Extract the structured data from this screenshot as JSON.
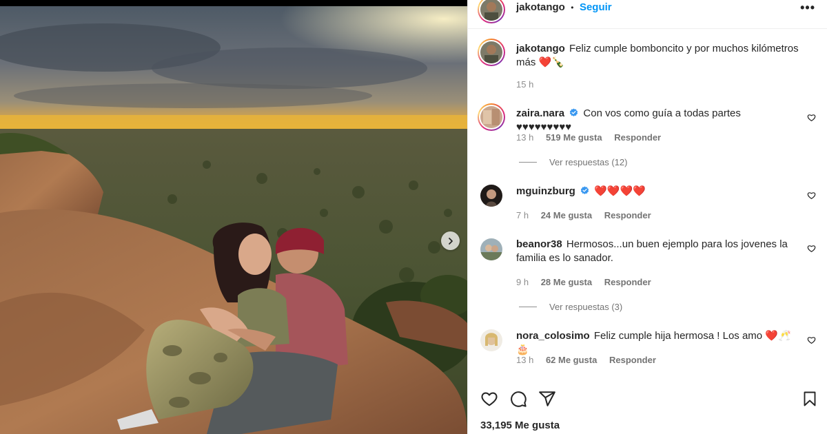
{
  "post": {
    "author": "jakotango",
    "separator": "•",
    "follow_label": "Seguir",
    "more_label": "•••",
    "caption_user": "jakotango",
    "caption_text": "Feliz cumple bomboncito y por muchos kilómetros más",
    "caption_emoji": "❤️🍾",
    "caption_time": "15 h",
    "likes": "33,195 Me gusta"
  },
  "comments": [
    {
      "user": "zaira.nara",
      "verified": true,
      "text": "Con vos como guía a todas partes ♥♥♥♥♥♥♥♥♥",
      "time": "13 h",
      "likes": "519 Me gusta",
      "reply": "Responder",
      "view_replies": "Ver respuestas (12)"
    },
    {
      "user": "mguinzburg",
      "verified": true,
      "text": "",
      "emoji": "❤️❤️❤️❤️",
      "time": "7 h",
      "likes": "24 Me gusta",
      "reply": "Responder"
    },
    {
      "user": "beanor38",
      "verified": false,
      "text": "Hermosos...un buen ejemplo para los jovenes la familia es lo sanador.",
      "time": "9 h",
      "likes": "28 Me gusta",
      "reply": "Responder",
      "view_replies": "Ver respuestas (3)"
    },
    {
      "user": "nora_colosimo",
      "verified": false,
      "text": "Feliz cumple hija hermosa ! Los amo",
      "emoji": "❤️🥂🎂",
      "time": "13 h",
      "likes": "62 Me gusta",
      "reply": "Responder"
    }
  ],
  "icons": {
    "like": "heart-icon",
    "comment": "comment-icon",
    "share": "share-icon",
    "save": "bookmark-icon",
    "next": "chevron-right-icon",
    "verified": "verified-badge-icon",
    "more": "more-options-icon"
  },
  "colors": {
    "follow": "#0095f6",
    "verified": "#3897f0",
    "secondary_text": "#8e8e8e"
  }
}
